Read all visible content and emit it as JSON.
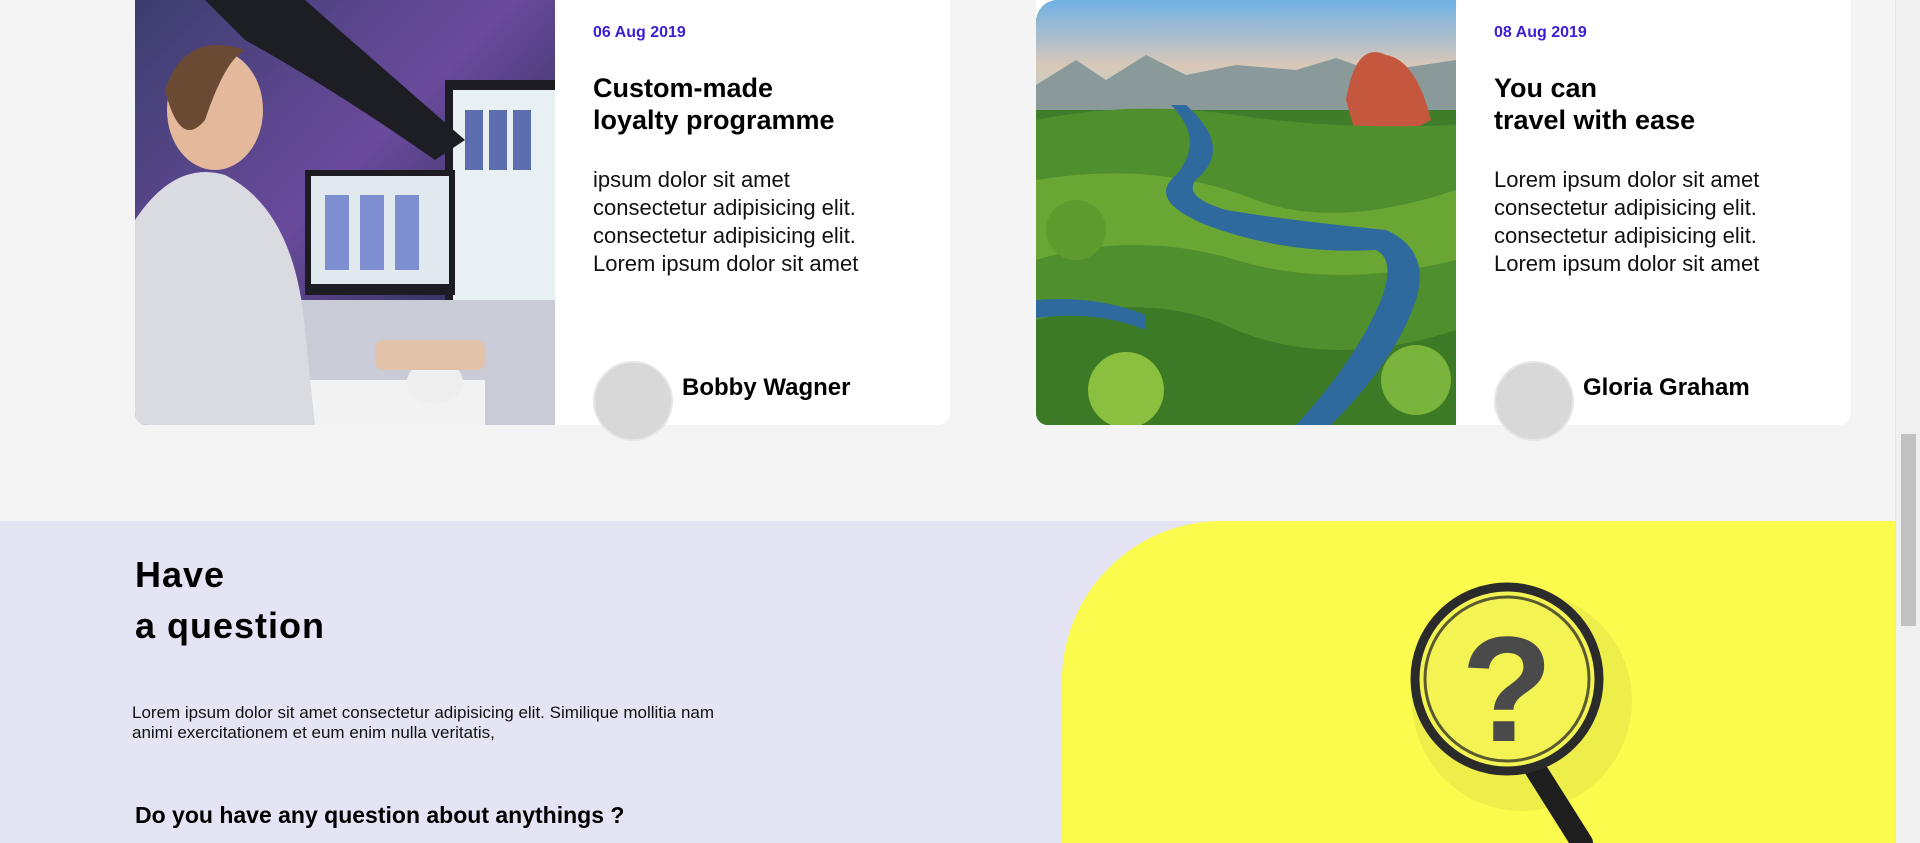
{
  "cards": [
    {
      "date": "06 Aug 2019",
      "title_line1": "Custom-made",
      "title_line2": "loyalty programme",
      "text_lines": [
        "ipsum dolor sit amet",
        "consectetur adipisicing elit.",
        "consectetur adipisicing elit.",
        "Lorem ipsum dolor sit amet"
      ],
      "author": "Bobby Wagner"
    },
    {
      "date": "08 Aug 2019",
      "title_line1": "You can",
      "title_line2": "travel with ease",
      "text_lines": [
        "Lorem ipsum dolor sit amet",
        "consectetur adipisicing elit.",
        "consectetur adipisicing elit.",
        "Lorem ipsum dolor sit amet"
      ],
      "author": "Gloria Graham"
    }
  ],
  "question": {
    "title_line1": "Have",
    "title_line2": "a question",
    "text": "Lorem ipsum dolor sit amet consectetur adipisicing elit. Similique mollitia nam animi exercitationem et eum enim nulla veritatis,",
    "subheading": "Do you have any question about anythings ?"
  },
  "colors": {
    "accent": "#3a1fd6",
    "page_bg": "#f4f4f4",
    "question_bg": "#e5e4f4",
    "question_image_bg": "#fbfb4e"
  },
  "icons": {
    "question_image": "magnifying-glass-question-mark"
  }
}
